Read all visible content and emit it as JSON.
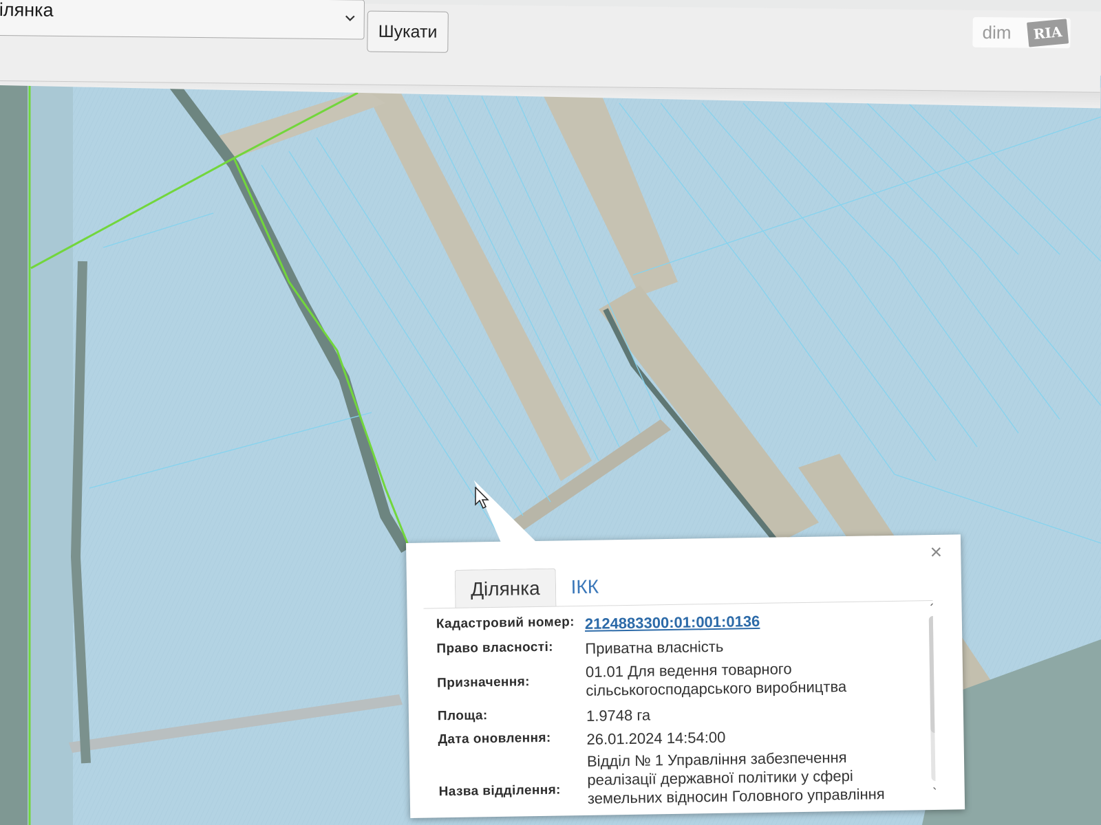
{
  "toolbar": {
    "select_value": "ілянка",
    "search_label": "Шукати"
  },
  "logo": {
    "dim": "dim",
    "ria": "RIA"
  },
  "popup": {
    "close_symbol": "×",
    "tabs": [
      {
        "label": "Ділянка",
        "active": true
      },
      {
        "label": "ІКК",
        "active": false
      }
    ],
    "fields": {
      "cadastral_label": "Кадастровий номер:",
      "cadastral_value": "2124883300:01:001:0136",
      "ownership_label": "Право власності:",
      "ownership_value": "Приватна власність",
      "purpose_label": "Призначення:",
      "purpose_value_1": "01.01 Для ведення товарного",
      "purpose_value_2": "сільськогосподарського виробництва",
      "area_label": "Площа:",
      "area_value": "1.9748 га",
      "updated_label": "Дата оновлення:",
      "updated_value": "26.01.2024 14:54:00",
      "department_label": "Назва відділення:",
      "department_value_1": "Відділ № 1 Управління забезпечення",
      "department_value_2": "реалізації державної політики у сфері",
      "department_value_3": "земельних відносин Головного управління"
    }
  },
  "colors": {
    "map_overlay": "#aecfe0",
    "parcel_line": "#7fd3ee",
    "boundary_green": "#6fd43a",
    "link_blue": "#2c6aa8"
  }
}
